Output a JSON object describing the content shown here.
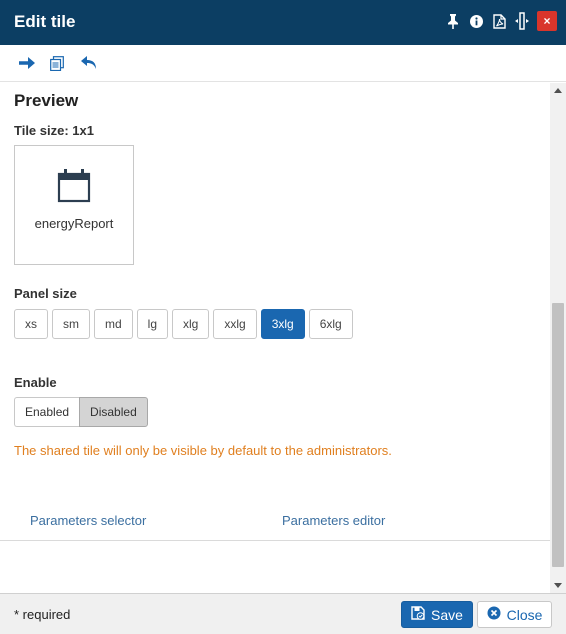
{
  "window": {
    "title": "Edit tile"
  },
  "titlebar_icons": [
    "pin-icon",
    "info-icon",
    "pdf-icon",
    "resize-icon",
    "close-icon"
  ],
  "titlebar_close_glyph": "×",
  "toolbar": {
    "icons": [
      "arrow-right-icon",
      "copy-icon",
      "undo-icon"
    ]
  },
  "preview": {
    "heading": "Preview",
    "tile_size": "Tile size: 1x1",
    "tile_icon": "calendar-icon",
    "tile_label": "energyReport"
  },
  "panel_size": {
    "label": "Panel size",
    "options": [
      "xs",
      "sm",
      "md",
      "lg",
      "xlg",
      "xxlg",
      "3xlg",
      "6xlg"
    ],
    "selected": "3xlg"
  },
  "enable": {
    "label": "Enable",
    "options": [
      "Enabled",
      "Disabled"
    ],
    "selected": "Disabled"
  },
  "warning_text": "The shared tile will only be visible by default to the administrators.",
  "tabs": [
    "Parameters selector",
    "Parameters editor"
  ],
  "footer": {
    "required_note": "* required",
    "save_label": "Save",
    "close_label": "Close"
  },
  "colors": {
    "titlebar_bg": "#0c3e63",
    "accent": "#1a67b0",
    "close_red": "#d9352b",
    "warning": "#e07f1f",
    "link": "#3b6fa0"
  }
}
